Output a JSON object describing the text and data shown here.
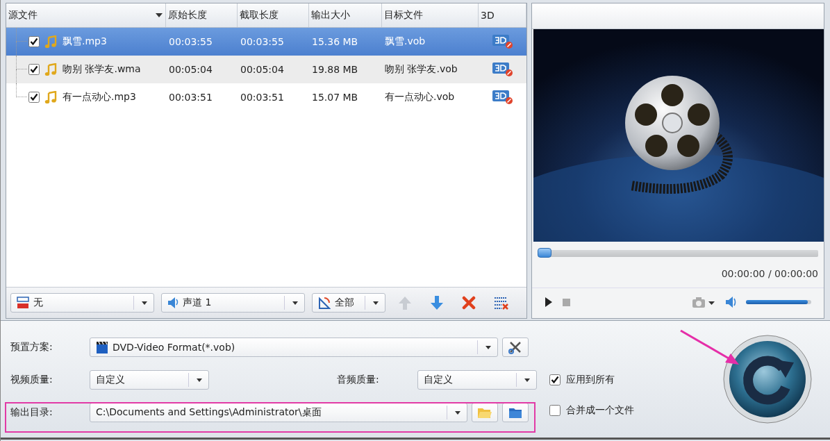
{
  "file_table": {
    "columns": [
      "源文件",
      "原始长度",
      "截取长度",
      "输出大小",
      "目标文件",
      "3D"
    ],
    "rows": [
      {
        "checked": true,
        "selected": true,
        "name": "飘雪.mp3",
        "original_length": "00:03:55",
        "clip_length": "00:03:55",
        "output_size": "15.36 MB",
        "target_file": "飘雪.vob"
      },
      {
        "checked": true,
        "selected": false,
        "name": "吻别 张学友.wma",
        "original_length": "00:05:04",
        "clip_length": "00:05:04",
        "output_size": "19.88 MB",
        "target_file": "吻别 张学友.vob"
      },
      {
        "checked": true,
        "selected": false,
        "name": "有一点动心.mp3",
        "original_length": "00:03:51",
        "clip_length": "00:03:51",
        "output_size": "15.07 MB",
        "target_file": "有一点动心.vob"
      }
    ]
  },
  "toolbar": {
    "subtitle": "无",
    "audio_track": "声道 1",
    "range": "全部"
  },
  "preview": {
    "seek": {
      "level": 0
    },
    "time": "00:00:00 / 00:00:00",
    "volume": {
      "level": 0.95
    }
  },
  "settings": {
    "preset_label": "预置方案:",
    "preset": "DVD-Video Format(*.vob)",
    "video_quality_label": "视频质量:",
    "video_quality": "自定义",
    "audio_quality_label": "音频质量:",
    "audio_quality": "自定义",
    "output_dir_label": "输出目录:",
    "output_dir": "C:\\Documents and Settings\\Administrator\\桌面",
    "options": [
      {
        "label": "应用到所有",
        "checked": true
      },
      {
        "label": "合并成一个文件",
        "checked": false
      }
    ]
  }
}
